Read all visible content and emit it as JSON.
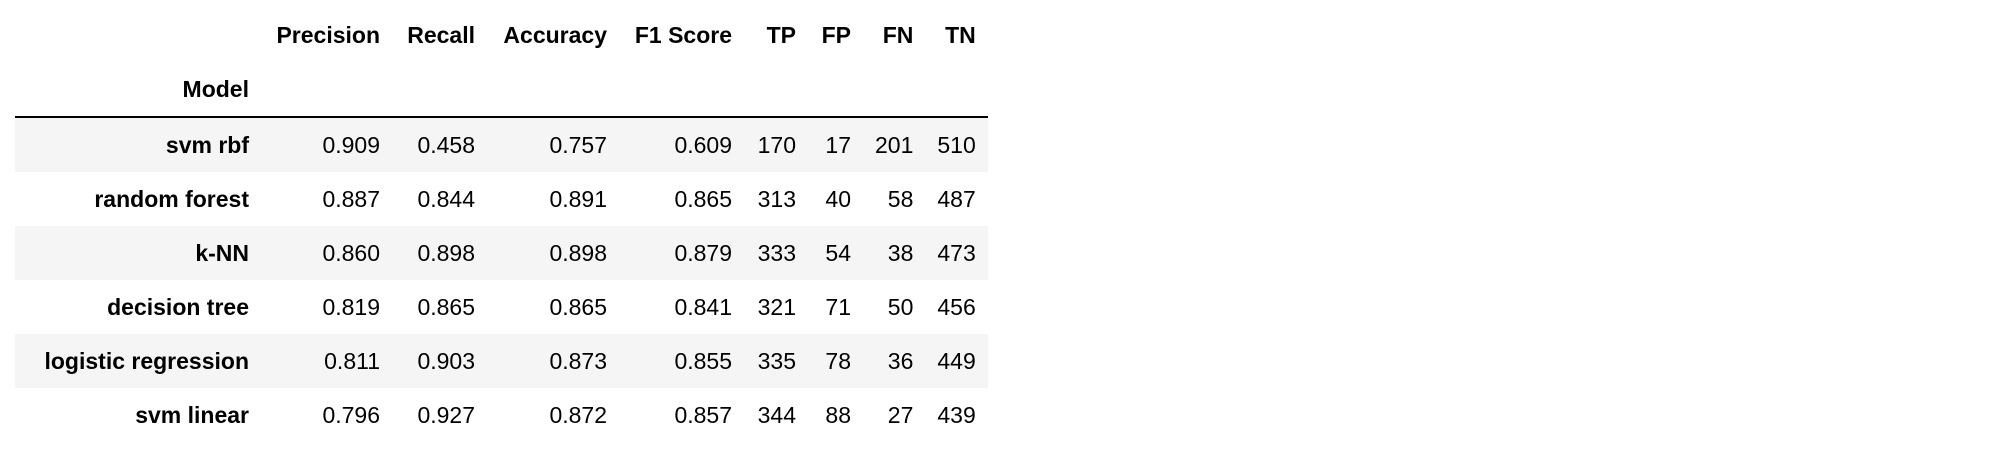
{
  "table": {
    "columns": [
      "Precision",
      "Recall",
      "Accuracy",
      "F1 Score",
      "TP",
      "FP",
      "FN",
      "TN"
    ],
    "index_name": "Model",
    "rows": [
      {
        "model": "svm rbf",
        "values": [
          "0.909",
          "0.458",
          "0.757",
          "0.609",
          "170",
          "17",
          "201",
          "510"
        ]
      },
      {
        "model": "random forest",
        "values": [
          "0.887",
          "0.844",
          "0.891",
          "0.865",
          "313",
          "40",
          "58",
          "487"
        ]
      },
      {
        "model": "k-NN",
        "values": [
          "0.860",
          "0.898",
          "0.898",
          "0.879",
          "333",
          "54",
          "38",
          "473"
        ]
      },
      {
        "model": "decision tree",
        "values": [
          "0.819",
          "0.865",
          "0.865",
          "0.841",
          "321",
          "71",
          "50",
          "456"
        ]
      },
      {
        "model": "logistic regression",
        "values": [
          "0.811",
          "0.903",
          "0.873",
          "0.855",
          "335",
          "78",
          "36",
          "449"
        ]
      },
      {
        "model": "svm linear",
        "values": [
          "0.796",
          "0.927",
          "0.872",
          "0.857",
          "344",
          "88",
          "27",
          "439"
        ]
      }
    ]
  },
  "colors": {
    "row_stripe": "#f5f5f5",
    "row_plain": "#ffffff",
    "header_rule": "#000000",
    "text": "#000000"
  }
}
